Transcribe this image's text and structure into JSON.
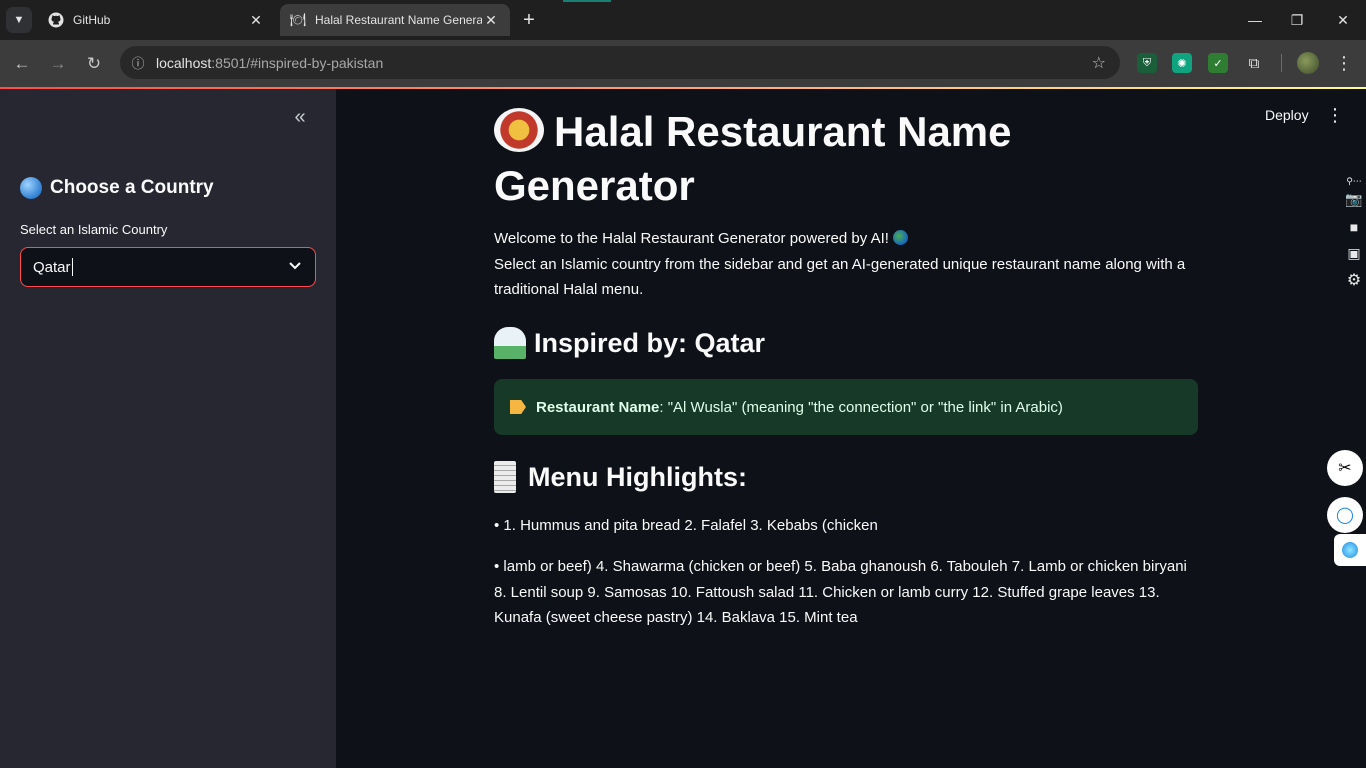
{
  "browser": {
    "tabs": [
      {
        "title": "GitHub",
        "icon": "github-icon",
        "active": false
      },
      {
        "title": "Halal Restaurant Name Generat",
        "icon": "plate-icon",
        "active": true
      }
    ],
    "url_host": "localhost",
    "url_path": ":8501/#inspired-by-pakistan",
    "accent_color": "#1a7f73"
  },
  "sidebar": {
    "header": "Choose a Country",
    "select_label": "Select an Islamic Country",
    "select_value": "Qatar"
  },
  "app": {
    "deploy_label": "Deploy",
    "title": "Halal Restaurant Name Generator",
    "intro_line1": "Welcome to the Halal Restaurant Generator powered by AI!",
    "intro_line2": "Select an Islamic country from the sidebar and get an AI-generated unique restaurant name along with a traditional Halal menu.",
    "inspired_heading": "Inspired by: Qatar",
    "restaurant_label": "Restaurant Name",
    "restaurant_value": ": \"Al Wusla\" (meaning \"the connection\" or \"the link\" in Arabic)",
    "menu_heading": "Menu Highlights:",
    "menu_items": [
      "• 1. Hummus and pita bread 2. Falafel 3. Kebabs (chicken",
      "• lamb or beef) 4. Shawarma (chicken or beef) 5. Baba ghanoush 6. Tabouleh 7. Lamb or chicken biryani 8. Lentil soup 9. Samosas 10. Fattoush salad 11. Chicken or lamb curry 12. Stuffed grape leaves 13. Kunafa (sweet cheese pastry) 14. Baklava 15. Mint tea"
    ],
    "colors": {
      "primary": "#ff4b4b",
      "background": "#0e1117",
      "sidebar": "#262730",
      "success_bg": "#173928"
    }
  }
}
